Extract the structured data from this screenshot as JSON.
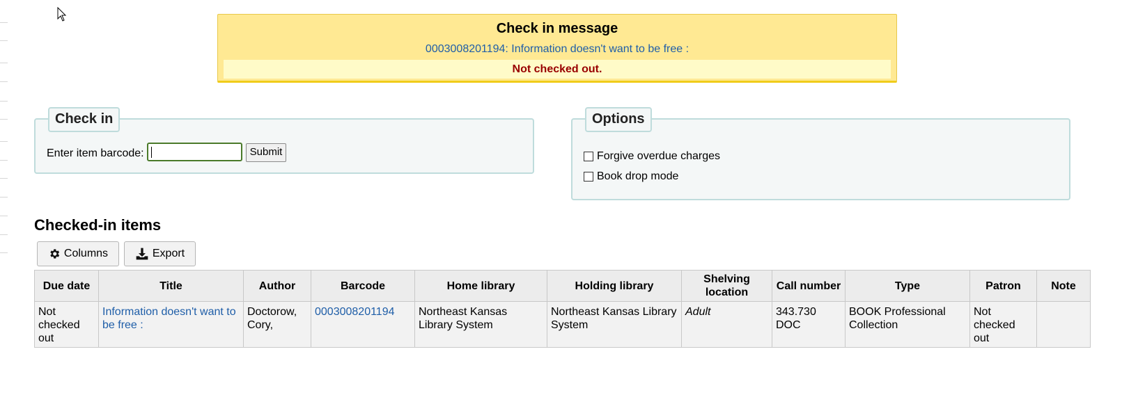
{
  "alert": {
    "heading": "Check in message",
    "item_link": "0003008201194: Information doesn't want to be free :",
    "status": "Not checked out."
  },
  "checkin": {
    "legend": "Check in",
    "barcode_label": "Enter item barcode:",
    "barcode_value": "",
    "submit_label": "Submit"
  },
  "options": {
    "legend": "Options",
    "forgive_label": "Forgive overdue charges",
    "forgive_checked": false,
    "bookdrop_label": "Book drop mode",
    "bookdrop_checked": false
  },
  "checked_in": {
    "title": "Checked-in items",
    "columns_button": "Columns",
    "export_button": "Export",
    "headers": [
      "Due date",
      "Title",
      "Author",
      "Barcode",
      "Home library",
      "Holding library",
      "Shelving location",
      "Call number",
      "Type",
      "Patron",
      "Note"
    ],
    "rows": [
      {
        "due_date": "Not checked out",
        "title": "Information doesn't want to be free :",
        "author": "Doctorow, Cory,",
        "barcode": "0003008201194",
        "home_library": "Northeast Kansas Library System",
        "holding_library": "Northeast Kansas Library System",
        "shelving_location": "Adult",
        "call_number": "343.730 DOC",
        "type": "BOOK Professional Collection",
        "patron": "Not checked out",
        "note": ""
      }
    ]
  },
  "colors": {
    "alert_bg": "#ffe993",
    "alert_status": "#990000",
    "link": "#1f5ea8",
    "fieldset_border": "#bfdcdc"
  },
  "icons": {
    "columns": "gear-icon",
    "export": "download-icon"
  }
}
